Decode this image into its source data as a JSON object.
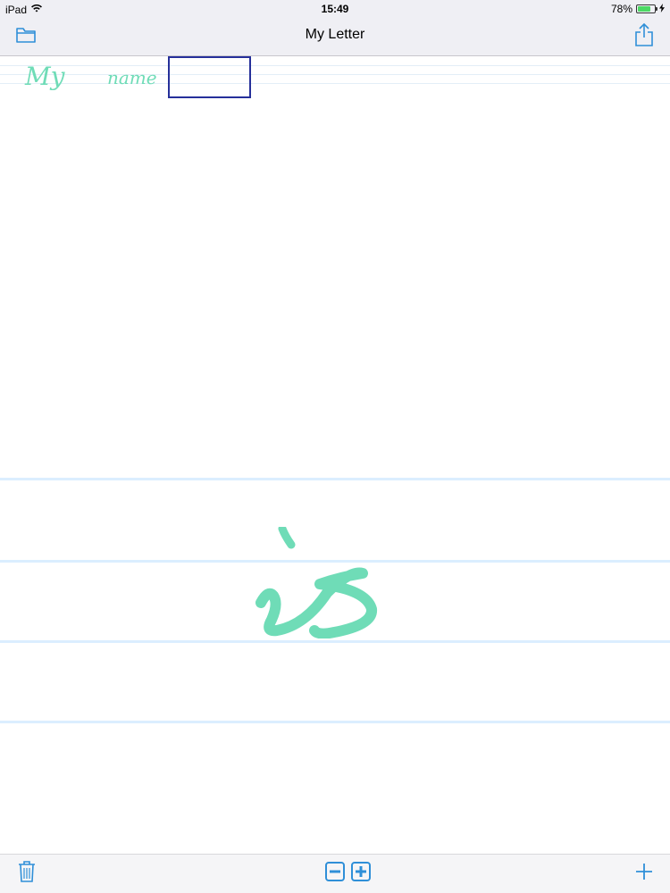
{
  "status_bar": {
    "device": "iPad",
    "time": "15:49",
    "battery": "78%",
    "battery_level": 0.78
  },
  "nav": {
    "title": "My Letter",
    "left_icon": "folder-icon",
    "right_icon": "share-icon"
  },
  "preview": {
    "words": [
      "My",
      "name"
    ]
  },
  "writing": {
    "word": "is"
  },
  "toolbar": {
    "left_icon": "trash-icon",
    "zoom_out_icon": "zoom-out-icon",
    "zoom_in_icon": "zoom-in-icon",
    "right_icon": "plus-icon"
  },
  "colors": {
    "accent": "#2f8fd8",
    "ink": "#6fdcb7",
    "selection": "#26309a",
    "guide": "#dbeeff"
  }
}
